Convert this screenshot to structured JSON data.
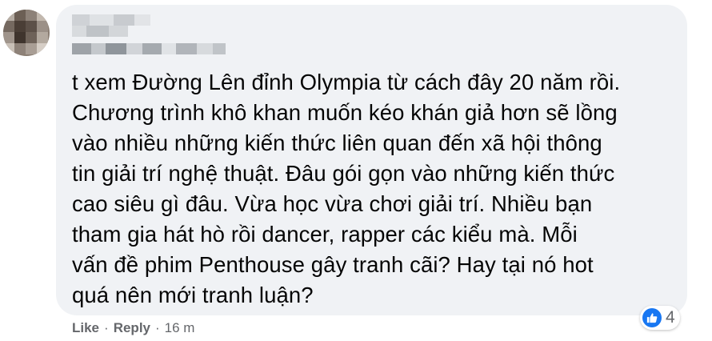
{
  "comment": {
    "lines": [
      "t xem Đường Lên đỉnh Olympia từ cách đây 20 năm rồi.",
      "Chương trình khô khan muốn kéo khán giả hơn sẽ lồng",
      "vào nhiều những kiến thức liên quan đến xã hội thông",
      "tin giải trí nghệ thuật. Đâu gói gọn vào những kiến thức",
      "cao siêu gì đâu. Vừa học vừa chơi giải trí. Nhiều bạn",
      "tham gia hát hò rồi dancer, rapper các kiểu mà. Mỗi",
      "vấn đề phim Penthouse gây tranh cãi? Hay tại nó hot",
      "quá nên mới tranh luận?"
    ]
  },
  "reaction": {
    "icon": "like-icon",
    "color": "#1877f2",
    "count": "4"
  },
  "actions": {
    "like_label": "Like",
    "reply_label": "Reply",
    "separator": "·",
    "timestamp": "16 m"
  },
  "colors": {
    "bubble": "#f0f2f5",
    "text": "#050505",
    "meta": "#65676b"
  }
}
